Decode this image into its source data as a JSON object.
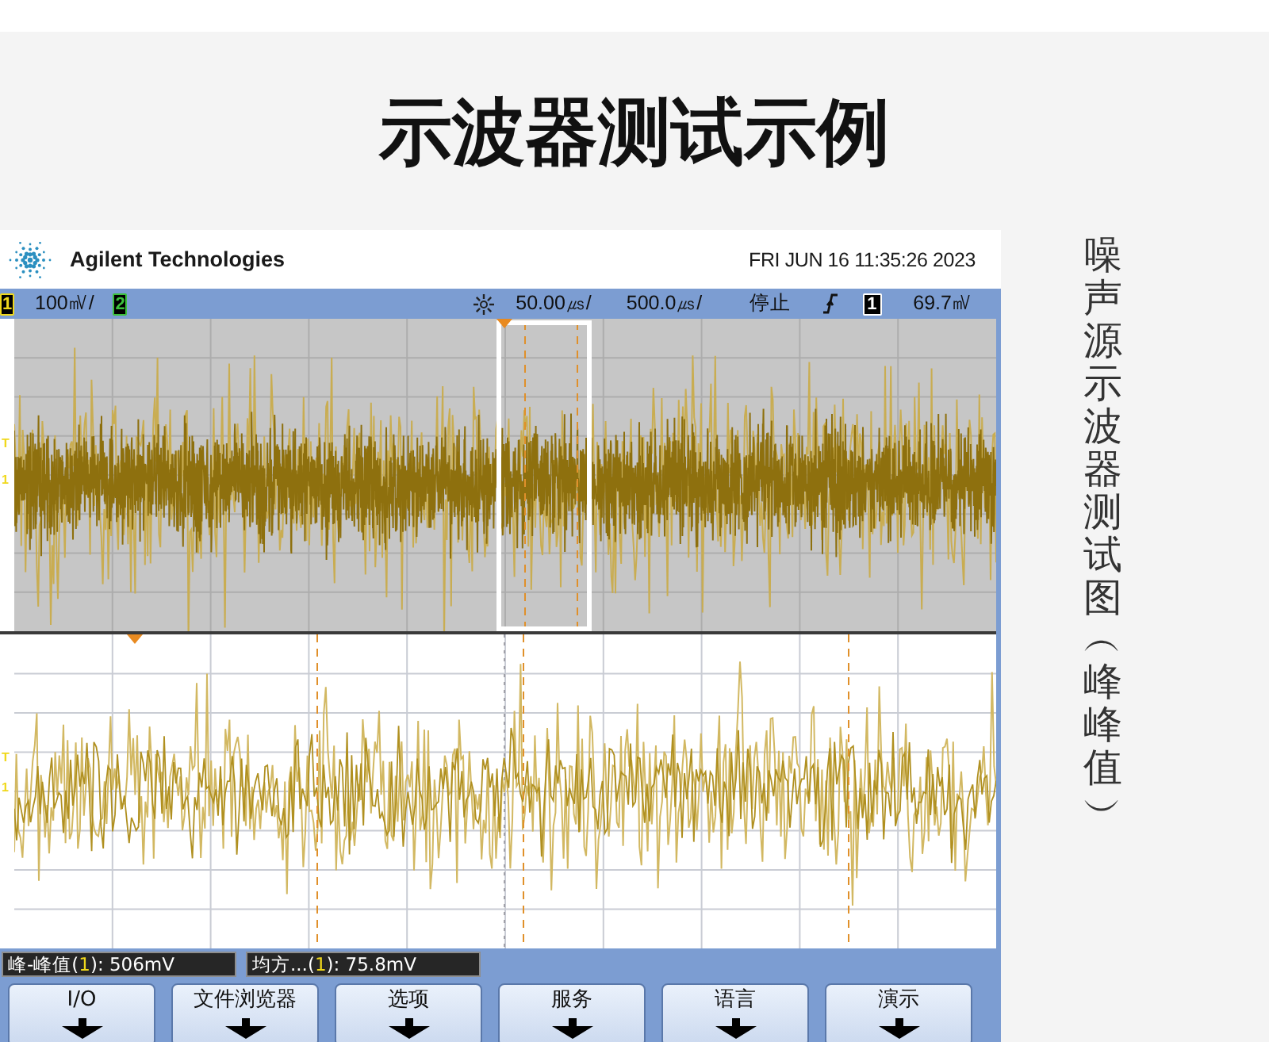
{
  "title": "示波器测试示例",
  "scope": {
    "header": {
      "brand": "Agilent Technologies",
      "datetime": "FRI JUN 16 11:35:26 2023"
    },
    "status_bar": {
      "channels": [
        {
          "label": "1",
          "scale": "100㎷/",
          "color": "#f0d81c"
        },
        {
          "label": "2",
          "color": "#3cc03c"
        }
      ],
      "zoom_timebase": "50.00㎲/",
      "main_timebase": "500.0㎲/",
      "run_state": "停止",
      "trigger": {
        "source": "1",
        "level": "69.7㎷"
      }
    },
    "upper_panel": {
      "markers": [
        "T",
        "1"
      ]
    },
    "lower_panel": {
      "markers": [
        "T",
        "1"
      ]
    },
    "measurements": [
      {
        "prefix": "峰-峰值(",
        "channel": "1",
        "suffix": "): 506mV"
      },
      {
        "prefix": "均方...(",
        "channel": "1",
        "suffix": "): 75.8mV"
      }
    ],
    "softkeys": [
      {
        "label": "I/O"
      },
      {
        "label": "文件浏览器"
      },
      {
        "label": "选项"
      },
      {
        "label": "服务"
      },
      {
        "label": "语言"
      },
      {
        "label": "演示"
      }
    ]
  },
  "side_caption": "噪声源示波器测试图︵峰峰值︶"
}
